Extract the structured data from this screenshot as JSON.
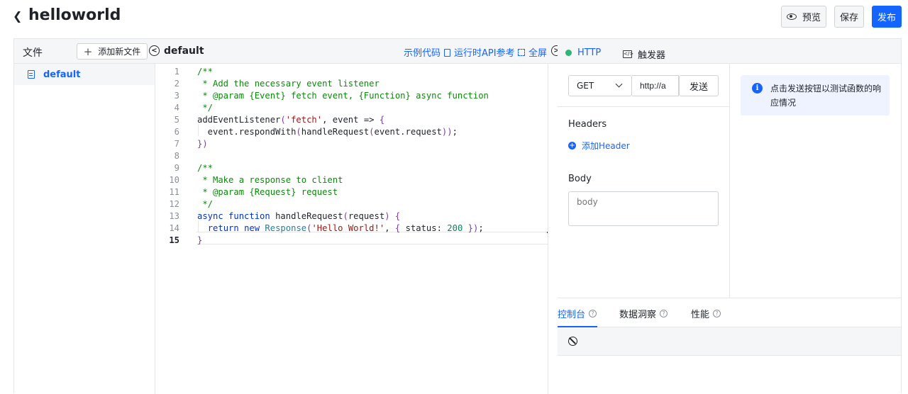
{
  "header": {
    "title": "helloworld",
    "preview_label": "预览",
    "save_label": "保存",
    "publish_label": "发布"
  },
  "files": {
    "title": "文件",
    "add_label": "添加新文件",
    "items": [
      {
        "label": "default"
      }
    ]
  },
  "editor": {
    "tab_label": "default",
    "links": {
      "sample_code": "示例代码",
      "runtime_api": "运行时API参考",
      "fullscreen": "全屏"
    },
    "active_line": 15,
    "lines": [
      "/**",
      " * Add the necessary event listener",
      " * @param {Event} fetch event, {Function} async function",
      " */",
      "addEventListener('fetch', event => {",
      "  event.respondWith(handleRequest(event.request));",
      "})",
      "",
      "/**",
      " * Make a response to client",
      " * @param {Request} request",
      " */",
      "async function handleRequest(request) {",
      "  return new Response('Hello World!', { status: 200 });",
      "}"
    ]
  },
  "debug": {
    "tabs": {
      "http": "HTTP",
      "trigger": "触发器"
    },
    "method": "GET",
    "url": "http://a",
    "send_label": "发送",
    "headers_label": "Headers",
    "add_header_label": "添加Header",
    "body_label": "Body",
    "body_placeholder": "body",
    "info_text": "点击发送按钮以测试函数的响应情况"
  },
  "console": {
    "tabs": [
      {
        "label": "控制台"
      },
      {
        "label": "数据洞察"
      },
      {
        "label": "性能"
      }
    ]
  },
  "colors": {
    "accent": "#1664ff",
    "status_dot": "#2bb673",
    "panel_bg": "#f5f6f7",
    "info_bg": "#eef3ff"
  }
}
